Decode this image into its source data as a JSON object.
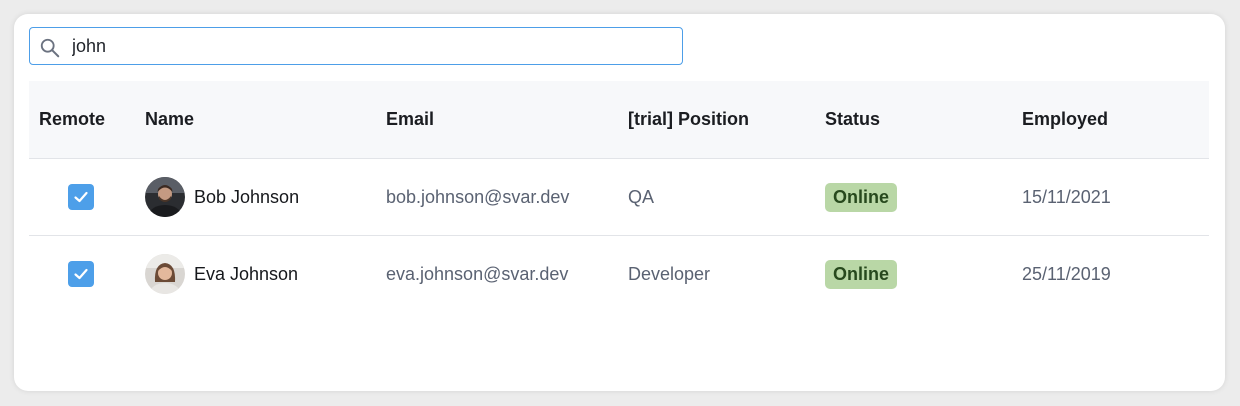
{
  "search": {
    "value": "john",
    "accent": "#4d9ee8"
  },
  "columns": {
    "remote": "Remote",
    "name": "Name",
    "email": "Email",
    "position": "[trial] Position",
    "status": "Status",
    "employed": "Employed"
  },
  "rows": [
    {
      "remote": true,
      "name": "Bob Johnson",
      "email": "bob.johnson@svar.dev",
      "position": "QA",
      "status": "Online",
      "employed": "15/11/2021",
      "avatar_icon": "person-photo-icon"
    },
    {
      "remote": true,
      "name": "Eva Johnson",
      "email": "eva.johnson@svar.dev",
      "position": "Developer",
      "status": "Online",
      "employed": "25/11/2019",
      "avatar_icon": "person-photo-icon"
    }
  ],
  "colors": {
    "checkbox": "#4d9fe9",
    "status_online_bg": "#b9d7a6",
    "status_online_text": "#27491d",
    "header_bg": "#f7f8fa"
  }
}
